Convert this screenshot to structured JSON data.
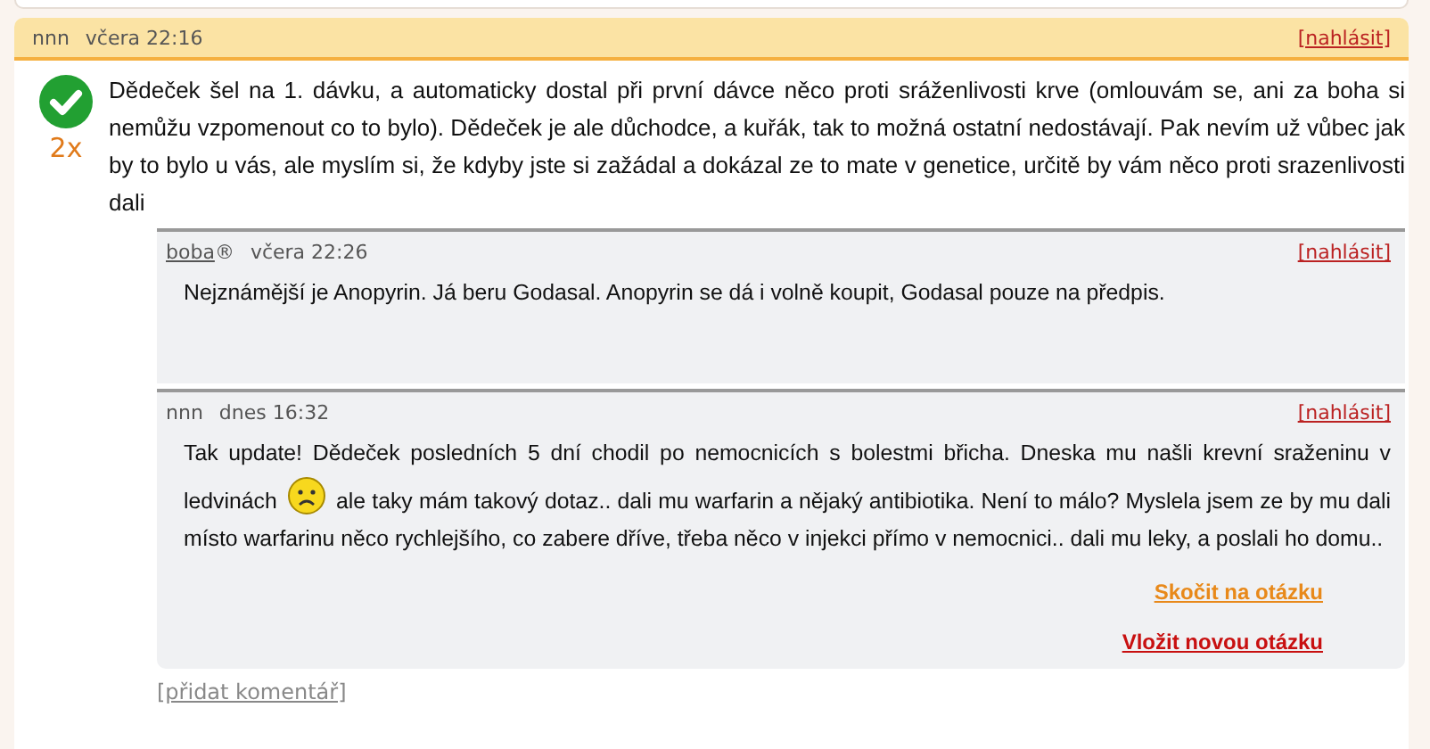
{
  "post": {
    "author": "nnn",
    "time": "včera 22:16",
    "report": "[nahlásit]",
    "accepted": true,
    "votes": "2x",
    "text": "Dědeček šel na 1. dávku, a automaticky dostal při první dávce něco proti sráženlivosti krve (omlouvám se, ani za boha si nemůžu vzpomenout co to bylo). Dědeček je ale důchodce, a kuřák, tak to možná ostatní nedostávají. Pak nevím už vůbec jak by to bylo u vás, ale myslím si, že kdyby jste si zažádal a dokázal ze to mate v genetice, určitě by vám něco proti srazenlivosti dali"
  },
  "comments": [
    {
      "author": "boba",
      "linked": true,
      "mark": "®",
      "time": "včera 22:26",
      "report": "[nahlásit]",
      "parts": [
        {
          "kind": "text",
          "text": "Nejznámější je Anopyrin. Já beru Godasal. Anopyrin se dá i volně koupit, Godasal pouze na předpis."
        }
      ]
    },
    {
      "author": "nnn",
      "linked": false,
      "time": "dnes 16:32",
      "report": "[nahlásit]",
      "parts": [
        {
          "kind": "text",
          "text": "Tak update! Dědeček posledních 5 dní chodil po nemocnicích s bolestmi břicha. Dneska mu našli krevní sraženinu v ledvinách "
        },
        {
          "kind": "emoticon"
        },
        {
          "kind": "text",
          "text": " ale taky mám takový dotaz.. dali mu warfarin a nějaký antibiotika. Není to málo? Myslela jsem ze by mu dali místo warfarinu něco rychlejšího, co zabere dříve, třeba něco v injekci přímo v nemocnici.. dali mu leky, a poslali ho domu.."
        }
      ],
      "actions": [
        {
          "kind": "jump",
          "label": "Skočit na otázku"
        },
        {
          "kind": "new",
          "label": "Vložit novou otázku"
        }
      ]
    }
  ],
  "add_comment": "[přidat komentář]"
}
